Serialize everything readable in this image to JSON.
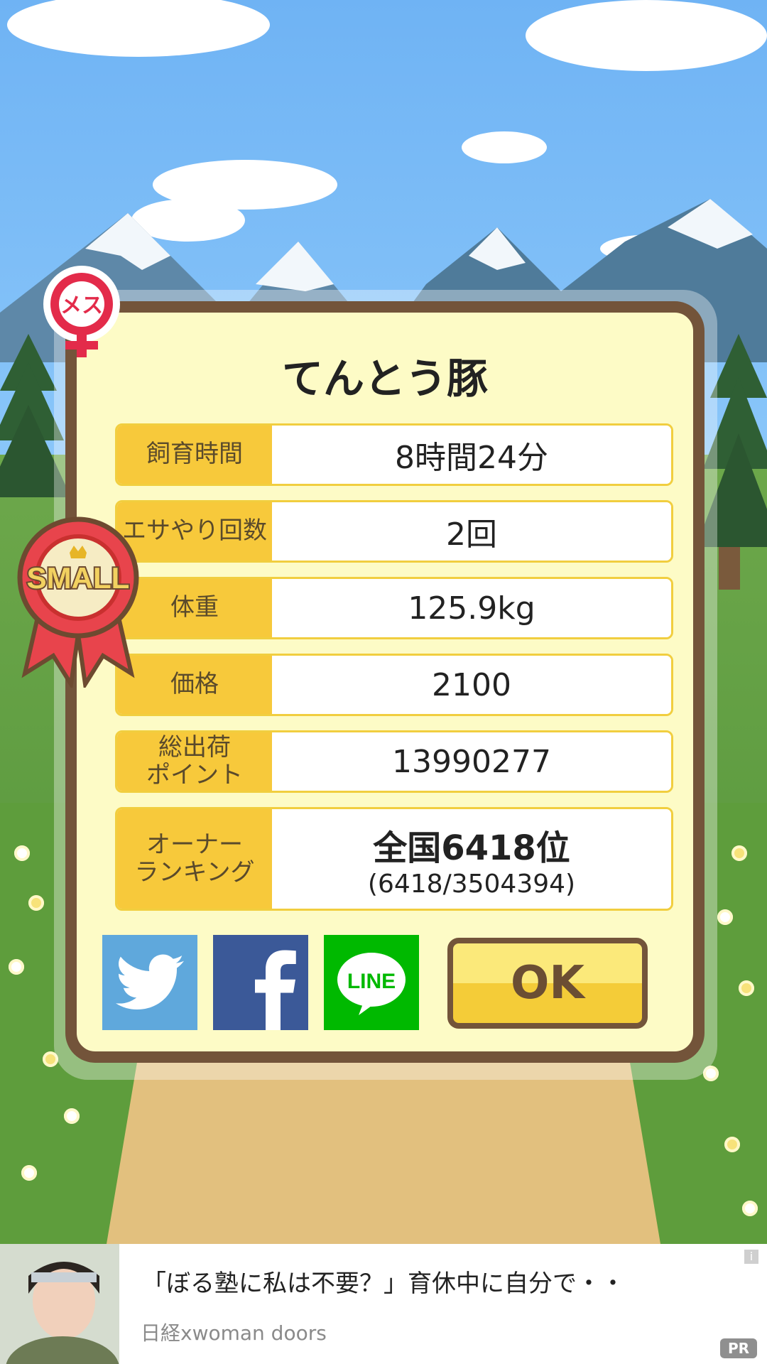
{
  "pig": {
    "name": "てんとう豚",
    "sex_badge": "メス",
    "size_badge": "SMALL"
  },
  "stats": [
    {
      "label": "飼育時間",
      "value": "8時間24分"
    },
    {
      "label": "エサやり回数",
      "value": "2回"
    },
    {
      "label": "体重",
      "value": "125.9kg"
    },
    {
      "label": "価格",
      "value": "2100"
    },
    {
      "label": "総出荷\nポイント",
      "value": "13990277"
    }
  ],
  "ranking": {
    "label": "オーナー\nランキング",
    "rank": "全国6418位",
    "detail": "(6418/3504394)"
  },
  "share": {
    "twitter_color": "#5fa8dc",
    "facebook_color": "#3b5998",
    "line_color": "#00b900",
    "line_text": "LINE"
  },
  "ok_label": "OK",
  "ad": {
    "title": "「ぼる塾に私は不要？」育休中に自分で・・",
    "source": "日経xwoman doors",
    "pr_label": "PR",
    "info_icon": "i"
  }
}
